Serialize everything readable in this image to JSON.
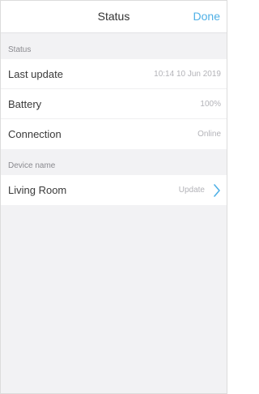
{
  "navbar": {
    "title": "Status",
    "done_label": "Done"
  },
  "status_section": {
    "header": "Status",
    "rows": [
      {
        "label": "Last update",
        "value": "10:14 10 Jun 2019"
      },
      {
        "label": "Battery",
        "value": "100%"
      },
      {
        "label": "Connection",
        "value": "Online"
      }
    ]
  },
  "device_section": {
    "header": "Device name",
    "row": {
      "label": "Living Room",
      "action_label": "Update"
    }
  },
  "colors": {
    "accent": "#4fb0e6",
    "background": "#f2f2f4",
    "value_text": "#b3b3b8"
  },
  "icons": {
    "disclosure": "chevron-right-icon"
  }
}
